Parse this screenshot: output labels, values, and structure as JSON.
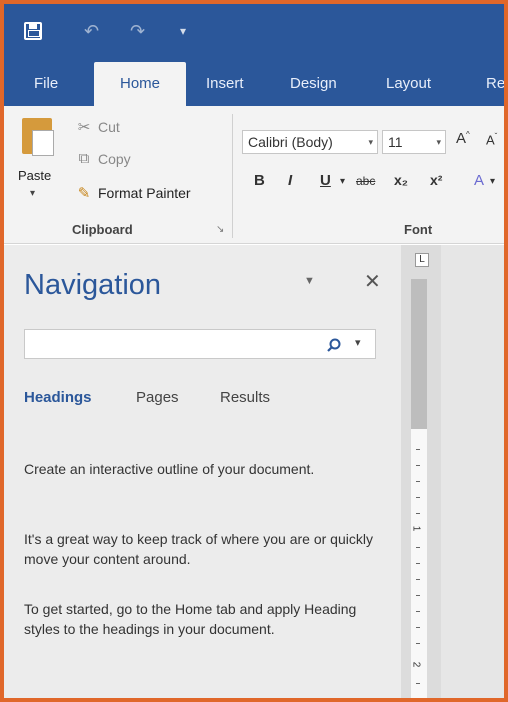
{
  "quick_access": {
    "save_icon": "save-icon",
    "undo_icon": "undo-icon",
    "redo_icon": "redo-icon",
    "customize_icon": "customize-icon"
  },
  "tabs": [
    {
      "label": "File"
    },
    {
      "label": "Home"
    },
    {
      "label": "Insert"
    },
    {
      "label": "Design"
    },
    {
      "label": "Layout"
    },
    {
      "label": "Refe"
    }
  ],
  "clipboard": {
    "paste_label": "Paste",
    "cut_label": "Cut",
    "copy_label": "Copy",
    "format_painter_label": "Format Painter",
    "group_label": "Clipboard"
  },
  "font": {
    "font_name": "Calibri (Body)",
    "font_size": "11",
    "group_label": "Font",
    "bold": "B",
    "italic": "I",
    "underline": "U",
    "strike": "abc",
    "subscript": "x₂",
    "superscript": "x²"
  },
  "navigation": {
    "title": "Navigation",
    "search_placeholder": "",
    "tabs": [
      {
        "label": "Headings"
      },
      {
        "label": "Pages"
      },
      {
        "label": "Results"
      }
    ],
    "text1": "Create an interactive outline of your document.",
    "text2": "It's a great way to keep track of where you are or quickly move your content around.",
    "text3": "To get started, go to the Home tab and apply Heading styles to the headings in your document."
  },
  "ruler": {
    "corner": "L",
    "numbers": [
      "1",
      "2"
    ]
  },
  "colors": {
    "accent": "#2b579a",
    "frame": "#e0672a"
  }
}
